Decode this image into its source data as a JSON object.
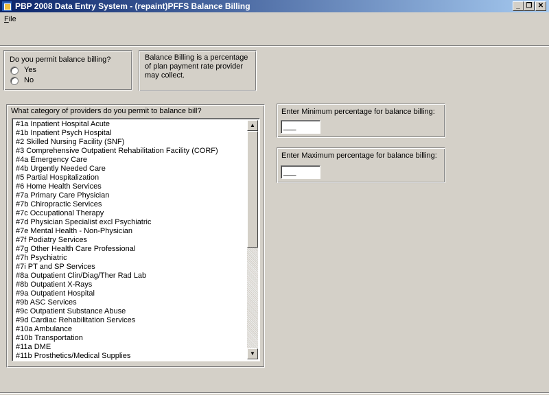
{
  "window": {
    "title": "PBP 2008 Data Entry System - (repaint)PFFS Balance Billing",
    "buttons": {
      "minimize": "_",
      "restore": "❐",
      "close": "✕"
    }
  },
  "menu": {
    "file_hotkey": "F",
    "file_rest": "ile"
  },
  "permit_group": {
    "question": "Do you permit balance billing?",
    "options": [
      "Yes",
      "No"
    ]
  },
  "info_text": "Balance Billing is a percentage of plan payment rate provider may collect.",
  "category_group": {
    "question": "What category of providers do you permit to balance bill?",
    "items": [
      "#1a Inpatient Hospital Acute",
      "#1b Inpatient Psych Hospital",
      "#2 Skilled Nursing Facility (SNF)",
      "#3 Comprehensive Outpatient Rehabilitation Facility (CORF)",
      "#4a Emergency Care",
      "#4b Urgently Needed Care",
      "#5 Partial Hospitalization",
      "#6 Home Health Services",
      "#7a Primary Care Physician",
      "#7b Chiropractic Services",
      "#7c Occupational Therapy",
      "#7d Physician Specialist excl Psychiatric",
      "#7e Mental Health - Non-Physician",
      "#7f Podiatry Services",
      "#7g Other Health Care Professional",
      "#7h Psychiatric",
      "#7i PT and SP Services",
      "#8a Outpatient Clin/Diag/Ther Rad Lab",
      "#8b Outpatient X-Rays",
      "#9a Outpatient Hospital",
      "#9b ASC Services",
      "#9c Outpatient Substance Abuse",
      "#9d Cardiac Rehabilitation Services",
      "#10a Ambulance",
      "#10b Transportation",
      "#11a DME",
      "#11b Prosthetics/Medical Supplies"
    ],
    "scroll_up": "▲",
    "scroll_down": "▼"
  },
  "min_group": {
    "label": "Enter Minimum percentage for balance billing:",
    "value": "___"
  },
  "max_group": {
    "label": "Enter Maximum percentage for balance billing:",
    "value": "___"
  }
}
